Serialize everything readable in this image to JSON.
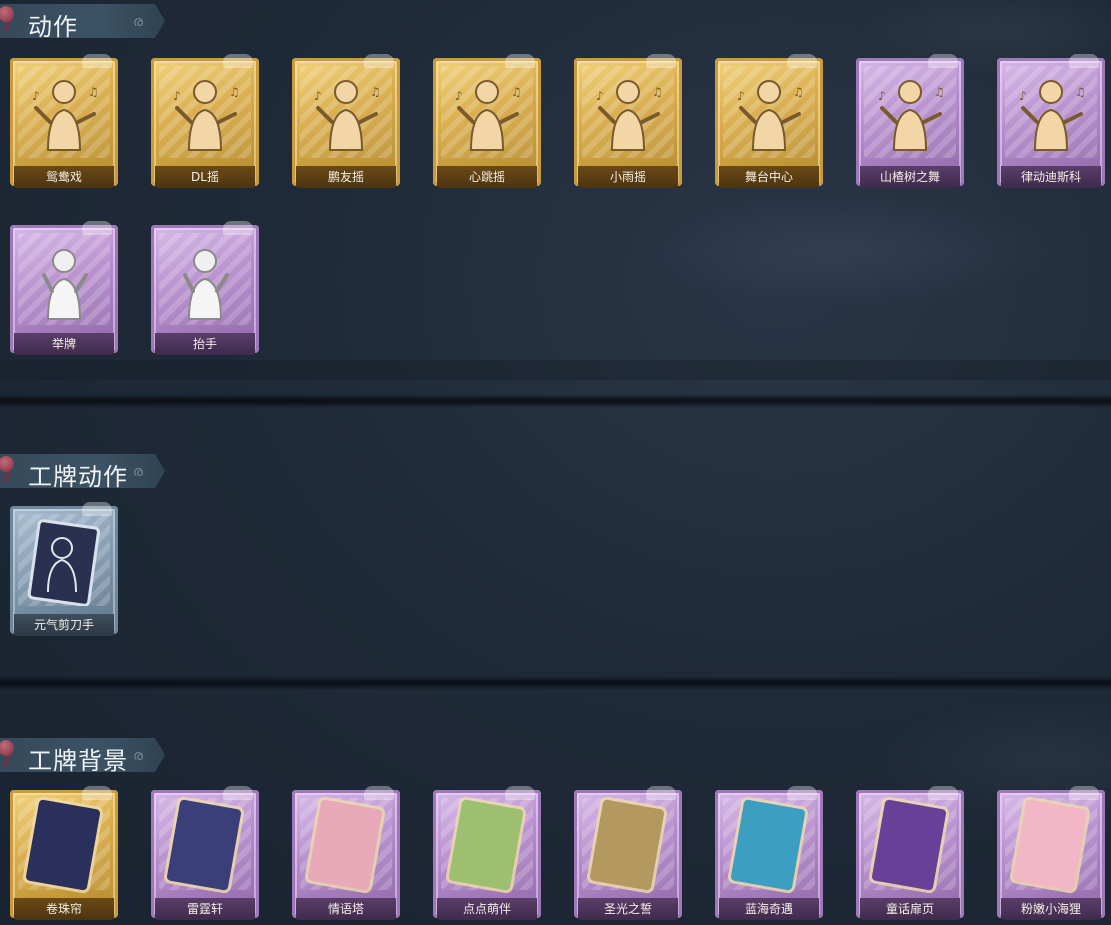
{
  "sections": [
    {
      "title": "动作",
      "items": [
        {
          "label": "鸳鸯戏",
          "tier": "gold",
          "icon": "dance-pose-icon"
        },
        {
          "label": "DL摇",
          "tier": "gold",
          "icon": "dance-pose-icon"
        },
        {
          "label": "鹏友摇",
          "tier": "gold",
          "icon": "dance-pose-icon"
        },
        {
          "label": "心跳摇",
          "tier": "gold",
          "icon": "dance-pose-icon"
        },
        {
          "label": "小雨摇",
          "tier": "gold",
          "icon": "dance-pose-icon"
        },
        {
          "label": "舞台中心",
          "tier": "gold",
          "icon": "dance-pose-icon"
        },
        {
          "label": "山楂树之舞",
          "tier": "purple",
          "icon": "dance-pose-icon"
        },
        {
          "label": "律动迪斯科",
          "tier": "purple",
          "icon": "dance-pose-icon"
        },
        {
          "label": "举牌",
          "tier": "purple",
          "icon": "hold-sign-icon"
        },
        {
          "label": "抬手",
          "tier": "purple",
          "icon": "raise-hand-icon"
        }
      ]
    },
    {
      "title": "工牌动作",
      "items": [
        {
          "label": "元气剪刀手",
          "tier": "blue",
          "icon": "badge-pose-icon"
        }
      ]
    },
    {
      "title": "工牌背景",
      "items": [
        {
          "label": "卷珠帘",
          "tier": "gold",
          "icon": "badge-bg-icon",
          "art": "#2b2f5c"
        },
        {
          "label": "雷霆轩",
          "tier": "purple",
          "icon": "badge-bg-icon",
          "art": "#3a3f7a"
        },
        {
          "label": "情语塔",
          "tier": "purple",
          "icon": "badge-bg-icon",
          "art": "#e8a9b8"
        },
        {
          "label": "点点萌伴",
          "tier": "purple",
          "icon": "badge-bg-icon",
          "art": "#9cc070"
        },
        {
          "label": "圣光之誓",
          "tier": "purple",
          "icon": "badge-bg-icon",
          "art": "#b39860"
        },
        {
          "label": "蓝海奇遇",
          "tier": "purple",
          "icon": "badge-bg-icon",
          "art": "#3c9fc2"
        },
        {
          "label": "童话扉页",
          "tier": "purple",
          "icon": "badge-bg-icon",
          "art": "#6a3f98"
        },
        {
          "label": "粉嫩小海狸",
          "tier": "purple",
          "icon": "badge-bg-icon",
          "art": "#f2b6c6"
        }
      ]
    }
  ]
}
